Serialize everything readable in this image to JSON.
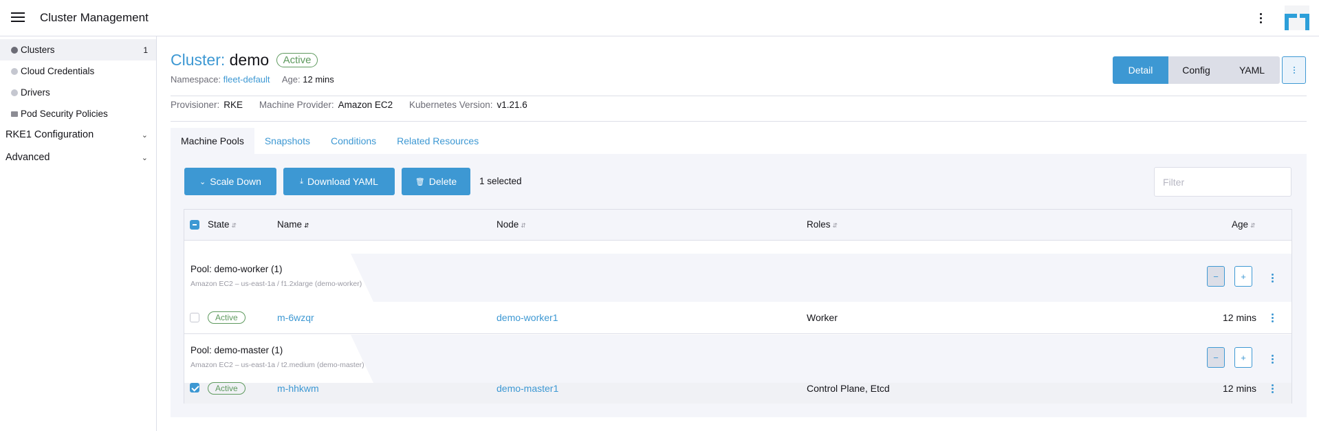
{
  "header": {
    "title": "Cluster Management"
  },
  "sidebar": {
    "items": [
      {
        "label": "Clusters",
        "count": "1"
      },
      {
        "label": "Cloud Credentials"
      },
      {
        "label": "Drivers"
      },
      {
        "label": "Pod Security Policies"
      }
    ],
    "groups": [
      {
        "label": "RKE1 Configuration"
      },
      {
        "label": "Advanced"
      }
    ]
  },
  "cluster": {
    "prefix": "Cluster:",
    "name": "demo",
    "state": "Active",
    "namespace_label": "Namespace:",
    "namespace": "fleet-default",
    "age_label": "Age:",
    "age": "12 mins",
    "provisioner_label": "Provisioner:",
    "provisioner": "RKE",
    "machine_provider_label": "Machine Provider:",
    "machine_provider": "Amazon EC2",
    "k8s_label": "Kubernetes Version:",
    "k8s_version": "v1.21.6"
  },
  "view_modes": [
    "Detail",
    "Config",
    "YAML"
  ],
  "tabs": [
    "Machine Pools",
    "Snapshots",
    "Conditions",
    "Related Resources"
  ],
  "toolbar": {
    "scale_down": "Scale Down",
    "download_yaml": "Download YAML",
    "delete": "Delete",
    "selected": "1 selected",
    "filter_placeholder": "Filter"
  },
  "table": {
    "columns": [
      "State",
      "Name",
      "Node",
      "Roles",
      "Age"
    ],
    "pools": [
      {
        "title": "Pool: demo-worker (1)",
        "subtitle": "Amazon EC2 – us-east-1a / f1.2xlarge (demo-worker)",
        "rows": [
          {
            "state": "Active",
            "name": "m-6wzqr",
            "node": "demo-worker1",
            "roles": "Worker",
            "age": "12 mins",
            "selected": false
          }
        ]
      },
      {
        "title": "Pool: demo-master (1)",
        "subtitle": "Amazon EC2 – us-east-1a / t2.medium (demo-master)",
        "rows": [
          {
            "state": "Active",
            "name": "m-hhkwm",
            "node": "demo-master1",
            "roles": "Control Plane, Etcd",
            "age": "12 mins",
            "selected": true
          }
        ]
      }
    ]
  }
}
